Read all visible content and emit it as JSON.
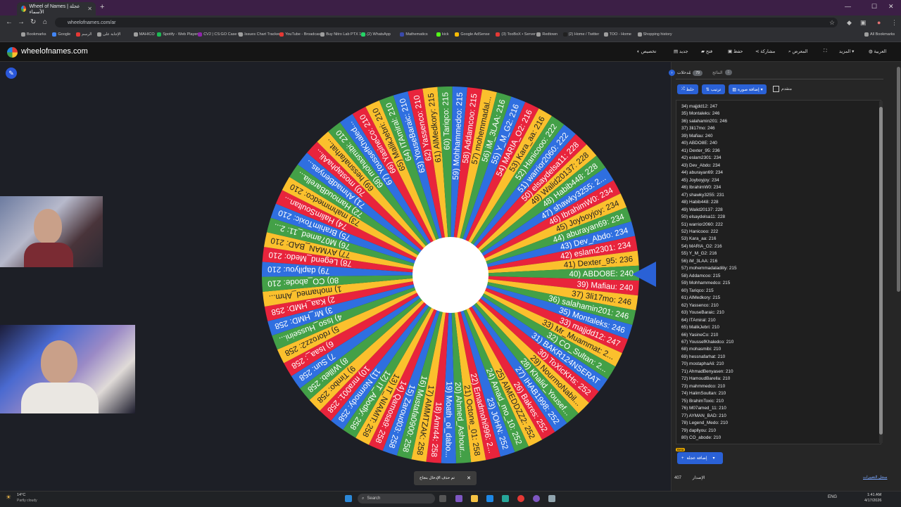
{
  "browser": {
    "tab_title": "Wheel of Names | عجلة الأسماء",
    "tab_close": "✕",
    "new_tab": "+",
    "url": "wheelofnames.com/ar",
    "window": {
      "minimize": "—",
      "maximize": "☐",
      "close": "✕"
    },
    "bookmarks": [
      {
        "label": "Bookmarks",
        "color": "#9e9e9e"
      },
      {
        "label": "Google",
        "color": "#4285f4"
      },
      {
        "label": "الرسم",
        "color": "#e53935"
      },
      {
        "label": "الإجابة على",
        "color": "#9e9e9e"
      },
      {
        "label": "MAHICO",
        "color": "#9e9e9e"
      },
      {
        "label": "Spotify - Web Player...",
        "color": "#1db954"
      },
      {
        "label": "CV2 | CS:GO Case O...",
        "color": "#8e24aa"
      },
      {
        "label": "Issues Chart Tracker",
        "color": "#9e9e9e"
      },
      {
        "label": "YouTube - Broadcas...",
        "color": "#e53935"
      },
      {
        "label": "Buy Nitro Lab PTX 10...",
        "color": "#9e9e9e"
      },
      {
        "label": "(2) WhatsApp",
        "color": "#25d366"
      },
      {
        "label": "Mathematics",
        "color": "#3949ab"
      },
      {
        "label": "kick",
        "color": "#53fc18"
      },
      {
        "label": "Google AdSense",
        "color": "#fbbc04"
      },
      {
        "label": "(3) TooBoX • Server",
        "color": "#e53935"
      },
      {
        "label": "Redtown",
        "color": "#9e9e9e"
      },
      {
        "label": "(2) Home / Twitter",
        "color": "#212121"
      },
      {
        "label": "TOO - Home",
        "color": "#9e9e9e"
      },
      {
        "label": "Shopping history",
        "color": "#9e9e9e"
      }
    ],
    "all_bookmarks": "All Bookmarks"
  },
  "header": {
    "site_name": "wheelofnames.com",
    "items": [
      "تخصيص",
      "جديد",
      "فتح",
      "حفظ",
      "مشاركة",
      "المعرض",
      "",
      "المزيد",
      "العربية"
    ]
  },
  "panel": {
    "tab_entries_label": "مُدخلات",
    "tab_entries_count": "79",
    "tab_results_label": "النتائج",
    "tab_results_count": "1",
    "btn_shuffle": "خلط",
    "btn_sort": "ترتيب",
    "btn_add_image": "إضافة صورة",
    "advanced_label": "متقدم",
    "entries": [
      "34) majjdd12: 247",
      "35) Montaleks: 246",
      "36) salahamin201: 246",
      "37) 3li17mo: 246",
      "39) Mafiau: 240",
      "40) ABDO8E: 240",
      "41) Dexter_95: 236",
      "42) eslam2301: 234",
      "43) Dev_Abdo: 234",
      "44) aburayan69: 234",
      "45) Joyboyjoy: 234",
      "46) IbrahimW0: 234",
      "47) shawky3255: 231",
      "48) Habib448: 228",
      "49) Walid20137: 228",
      "50) elsaydelsa11: 228",
      "51) warrior2060: 222",
      "52) Hanicooo: 222",
      "53) Kara_aa: 216",
      "54) MARIA_O2: 216",
      "55) Y_M_G2: 216",
      "56) iM_3LAA: 216",
      "57) mohemmadaladiliy: 215",
      "58) Addamcoo: 215",
      "59) Mohhammedco: 215",
      "60) Tariqco: 215",
      "61) AlMedkory: 215",
      "62) Yassenco: 210",
      "63) YouseBaraic: 210",
      "64) ITAmiral: 210",
      "65) MalikJebri: 210",
      "66) YasineCo: 210",
      "67) YoussefKhaledco: 210",
      "68) mohasmibi: 210",
      "69) hessnafarhat: 210",
      "70) mostaphaAli: 210",
      "71) AhmadBenyasen: 210",
      "72) HamoudBarella: 210",
      "73) mahmmedco: 210",
      "74) HalimSoultan: 210",
      "75) BrahimToxic: 210",
      "76) M07amed_11: 210",
      "77) AYMAN_BAD: 210",
      "78) Legend_Medo: 210",
      "79) dapllyou: 210",
      "80) CO_abode: 210"
    ],
    "beta": "Beta",
    "add_button": "إضافة عجلة",
    "version_label": "الإصدار",
    "version": "407",
    "changelog": "سجل التغييرات"
  },
  "wheel": {
    "segments": [
      "39) Mafiau: 240",
      "37) 3li17mo: 246",
      "36) salahamin201: 246",
      "35) Montaleks: 246",
      "33) majjdd12: 247",
      "33) Mr_Muammat: 2...",
      "32) CO_Sultan: 2...",
      "31) BAKR124NSERAT",
      "30) ToXicKHs: 252",
      "29) NourmoNabil...",
      "28) Khalid_Yousef...",
      "27) IHAB1998: 252",
      "26) Bakres: 252",
      "25) AIMEDDZZ2: 252",
      "24) Amad_mo_10: 252",
      "23) JOHN: 252",
      "22) Emadmohi996: 2...",
      "21) Octone_01: 258",
      "20) Ahmed_Ashour...",
      "19) Moath_ol_dabo...",
      "18) Amr44: 258",
      "17) AMMTZAK: 258",
      "16) Mustafa0900: 258",
      "15) Zaroud03: 258",
      "14) Qamosa9: 258",
      "13) IT_NIAMIT: 258",
      "12) IT_Abodly: 258",
      "11) Normody: 258",
      "10) mra001: 258",
      "9) Timbo: 258",
      "8) Willeb: 258",
      "7) Sun: 258",
      "6) Isaa_: 258",
      "5) rdorozz2: 258",
      "4) Isso_Husseini...",
      "3) Mr_HMD: 258",
      "2) Kaa_HMD: 258",
      "1) mohamed_Ahm...",
      "80) CO_abode: 210",
      "79) dapllyou: 210",
      "78) Legend_Medo: 210",
      "77) AYMAN_BAD: 210",
      "76) M07amed_11: 2...",
      "75) BrahimToxic: 210",
      "74) HalimSoultan...",
      "73) mahmmedco: 210",
      "72) HamoudBarella...",
      "71) AhmadBenyas...",
      "70) mostaphaAli...",
      "69) hessnafarhat...",
      "68) mohasmibi: 210",
      "67) YoussefKhaled...",
      "66) YasineCo: 210",
      "65) MalikJebri: 210",
      "64) ITAmiral: 210",
      "63) YouseBaraic: 210",
      "62) Yassenco: 210",
      "61) AlMedkory: 215",
      "60) Tariqco: 215",
      "59) Mohhammedco: 215",
      "58) Addamcoo: 215",
      "57) mohemmadal...",
      "56) iM_3LAA: 216",
      "55) Y_M_G2: 216",
      "54) MARIA_O2: 216",
      "53) Kara_aa: 216",
      "52) Hanicooo: 222",
      "51) warrior2060: 222",
      "50) elsaydelsa11: 228",
      "49) Walid20137: 228",
      "48) Habib448: 228",
      "47) shawky3255: 2...",
      "46) IbrahimW0: 234",
      "45) Joyboyjoy: 234",
      "44) aburayan69: 234",
      "43) Dev_Abdo: 234",
      "42) eslam2301: 234",
      "41) Dexter_95: 236",
      "40) ABDO8E: 240"
    ],
    "colors": [
      "#e8243c",
      "#fbc02d",
      "#43a047",
      "#2f6fe0"
    ]
  },
  "toast": {
    "text": "تم حذف الإدخال بنجاح",
    "close": "✕"
  },
  "taskbar": {
    "weather_temp": "14°C",
    "weather_desc": "Partly cloudy",
    "search": "Search",
    "lang": "ENG",
    "time": "1:41 AM",
    "date": "4/17/2026"
  }
}
